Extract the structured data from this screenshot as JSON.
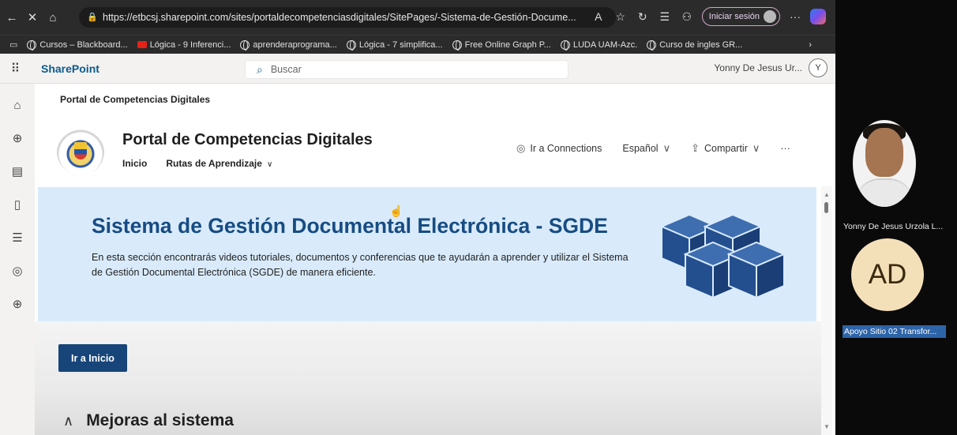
{
  "browser": {
    "url": "https://etbcsj.sharepoint.com/sites/portaldecompetenciasdigitales/SitePages/-Sistema-de-Gestión-Docume...",
    "signin_label": "Iniciar sesión"
  },
  "bookmarks": [
    "Cursos – Blackboard...",
    "Lógica - 9 Inferenci...",
    "aprenderaprograma...",
    "Lógica - 7 simplifica...",
    "Free Online Graph P...",
    "LUDA UAM-Azc.",
    "Curso de ingles GR..."
  ],
  "sharepoint": {
    "app_name": "SharePoint",
    "search_placeholder": "Buscar",
    "user_name": "Yonny De Jesus Ur...",
    "user_initial": "Y"
  },
  "page": {
    "breadcrumb": "Portal de Competencias Digitales",
    "site_title": "Portal de Competencias Digitales",
    "nav_home": "Inicio",
    "nav_routes": "Rutas de Aprendizaje",
    "connections": "Ir a Connections",
    "language": "Español",
    "share": "Compartir",
    "more": "···",
    "hero_title": "Sistema de Gestión Documental Electrónica - SGDE",
    "hero_text": "En esta sección encontrarás videos tutoriales, documentos y conferencias que te ayudarán a aprender y utilizar el Sistema de Gestión Documental Electrónica (SGDE) de manera eficiente.",
    "button_label": "Ir a Inicio",
    "section_title": "Mejoras al sistema"
  },
  "meeting": {
    "participant1": "Yonny De Jesus Urzola L...",
    "participant2_initials": "AD",
    "participant2": "Apoyo Sitio 02 Transfor..."
  },
  "colors": {
    "accent": "#17457a",
    "hero_bg": "#d9ebfb"
  }
}
